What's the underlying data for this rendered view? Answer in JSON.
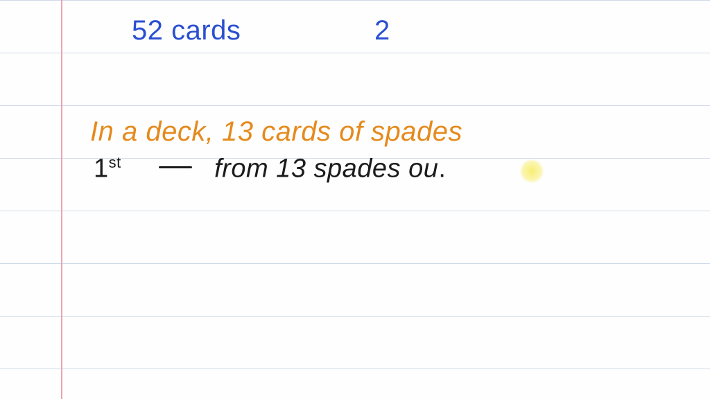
{
  "lines": {
    "count": 8,
    "spacing": 76,
    "first_y": 0
  },
  "header_blue": {
    "left": "52   cards",
    "right": "2"
  },
  "orange_line": "In a deck,   13 cards of spades",
  "black_line": {
    "first_ordinal_base": "1",
    "first_ordinal_sup": "st",
    "rest": "from  13   spades  ou",
    "tail_dot": "."
  }
}
